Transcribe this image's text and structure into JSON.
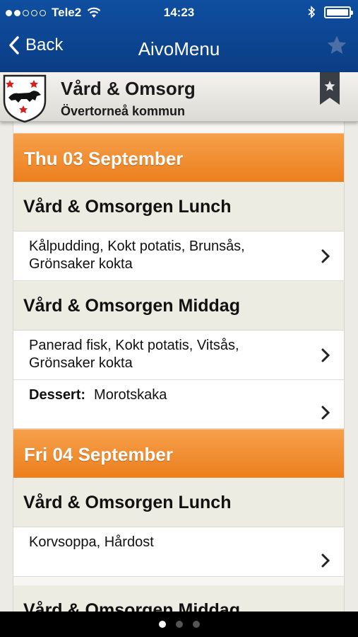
{
  "status_bar": {
    "carrier": "Tele2",
    "time": "14:23"
  },
  "nav": {
    "back_label": "Back",
    "title": "AivoMenu"
  },
  "header": {
    "name": "Vård & Omsorg",
    "municipality": "Övertorneå kommun"
  },
  "days": [
    {
      "label": "Thu 03 September",
      "meals": [
        {
          "title": "Vård & Omsorgen Lunch",
          "items": [
            {
              "line1": "Kålpudding, Kokt potatis, Brunsås,",
              "line2": "Grönsaker kokta"
            }
          ]
        },
        {
          "title": "Vård & Omsorgen Middag",
          "items": [
            {
              "line1": "Panerad fisk, Kokt potatis, Vitsås,",
              "line2": "Grönsaker kokta"
            },
            {
              "prefix": "Dessert:",
              "line1": "Morotskaka"
            }
          ]
        }
      ]
    },
    {
      "label": "Fri 04 September",
      "meals": [
        {
          "title": "Vård & Omsorgen Lunch",
          "items": [
            {
              "line1": "Korvsoppa, Hårdost"
            }
          ]
        },
        {
          "title": "Vård & Omsorgen Middag",
          "items": []
        }
      ]
    }
  ],
  "pager": {
    "pages": 3,
    "active": 1
  },
  "colors": {
    "nav_blue": "#0b3d85",
    "day_orange": "#ec7f1d",
    "meal_bg": "#edece2"
  }
}
